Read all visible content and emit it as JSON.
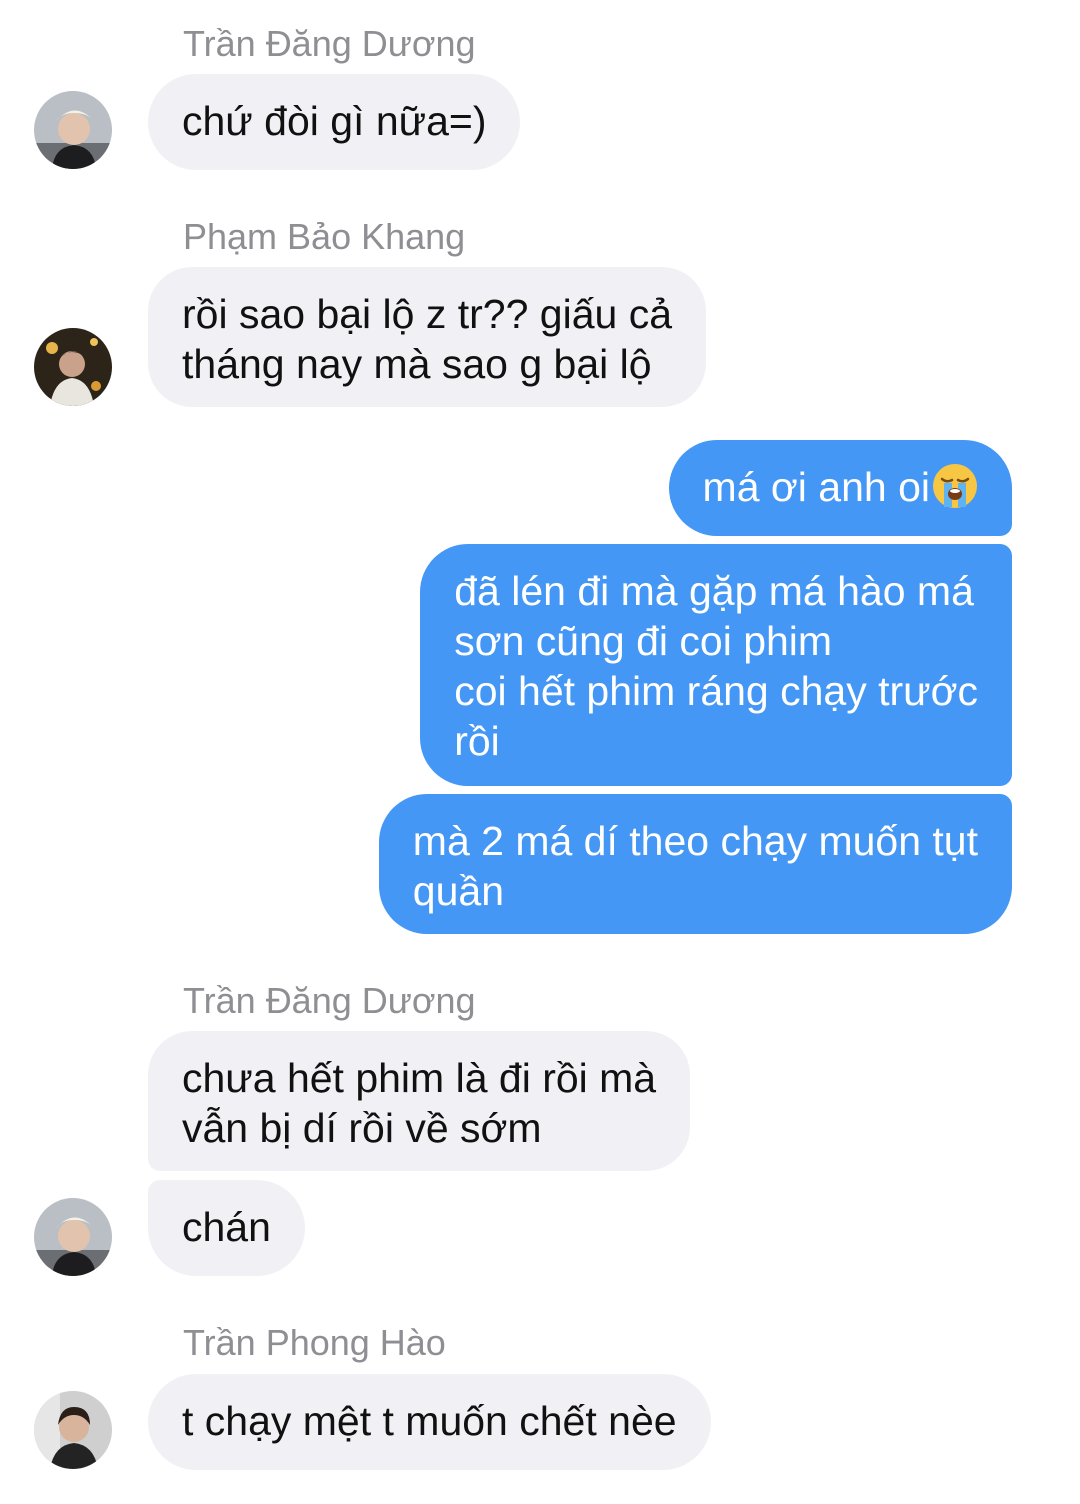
{
  "messages": [
    {
      "sender": "Trần Đăng Dương",
      "text": "chứ đòi gì nữa=)"
    },
    {
      "sender": "Phạm Bảo Khang",
      "line1": "rồi sao bại lộ z tr?? giấu cả",
      "line2": "tháng nay mà sao g bại lộ"
    },
    {
      "text": "má ơi anh oi",
      "emoji": "loudly-crying-face"
    },
    {
      "line1": "đã lén đi mà gặp má hào má",
      "line2": "sơn cũng đi coi phim",
      "line3": "coi hết phim ráng chạy trước",
      "line4": "rồi"
    },
    {
      "line1": "mà 2 má dí theo chạy muốn tụt",
      "line2": "quần"
    },
    {
      "sender": "Trần Đăng Dương",
      "line1": "chưa hết phim là đi rồi mà",
      "line2": "vẫn bị dí rồi về sớm"
    },
    {
      "text": "chán"
    },
    {
      "sender": "Trần Phong Hào",
      "text": "t chạy mệt t muốn chết nèe"
    }
  ],
  "colors": {
    "incoming_bubble": "#f1f1f5",
    "outgoing_bubble": "#4497f5",
    "sender_name": "#8e8e93"
  }
}
